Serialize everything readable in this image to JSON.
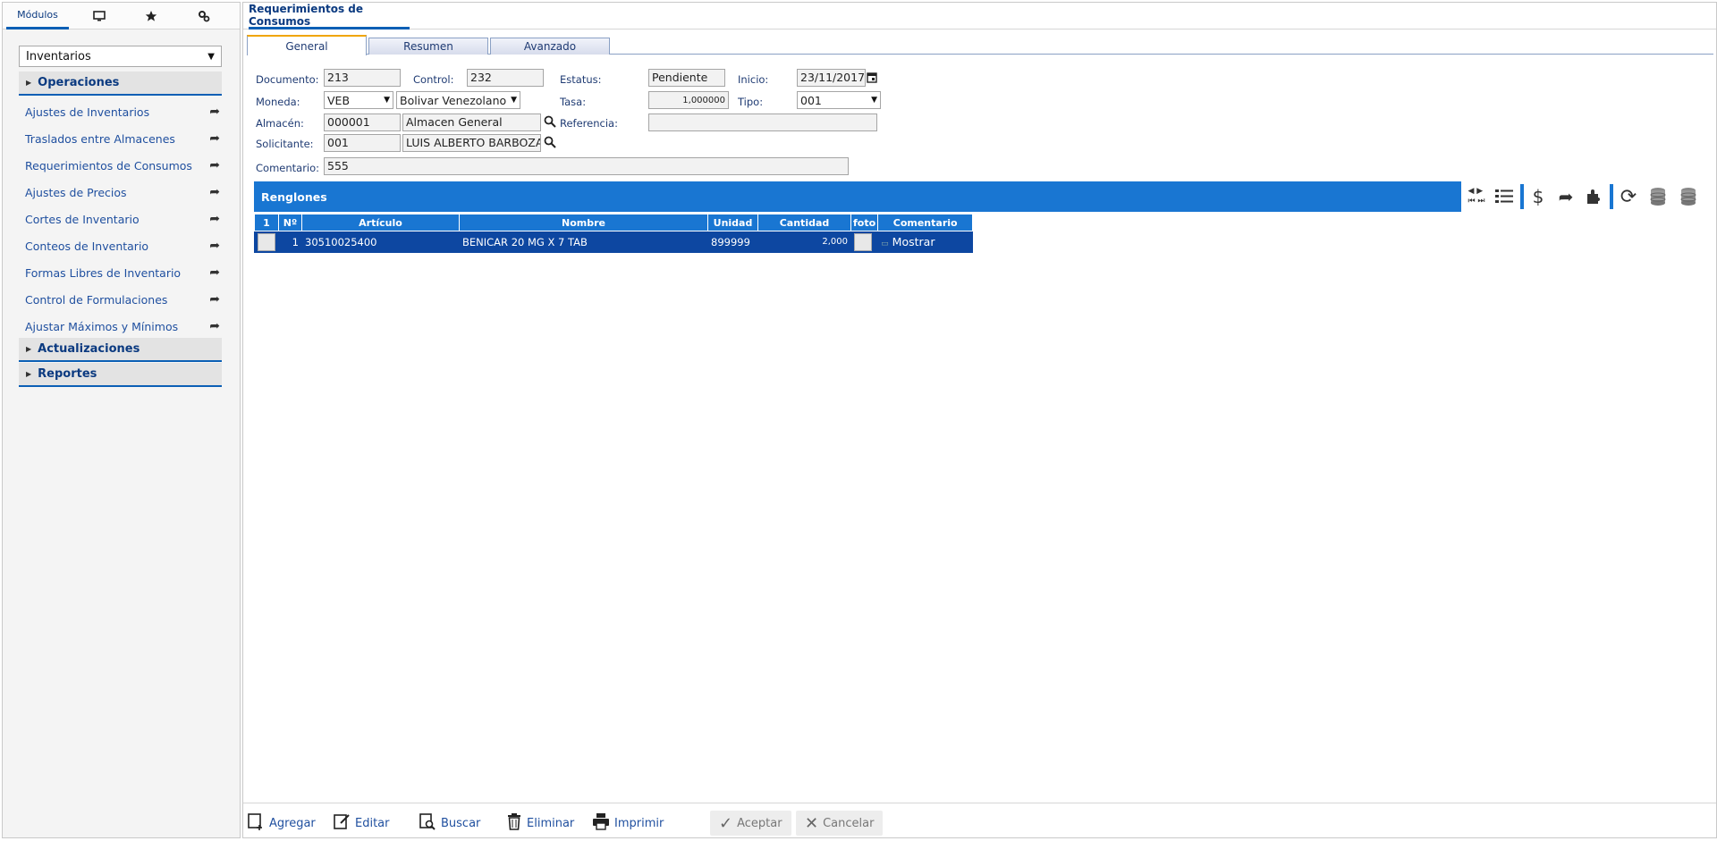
{
  "sidebar": {
    "tabs": [
      {
        "label": "Módulos",
        "icon": "modules"
      },
      {
        "label": "",
        "icon": "monitor-icon"
      },
      {
        "label": "",
        "icon": "star-icon"
      },
      {
        "label": "",
        "icon": "settings-icon"
      }
    ],
    "module_selected": "Inventarios",
    "sections": [
      {
        "label": "Operaciones"
      },
      {
        "label": "Actualizaciones"
      },
      {
        "label": "Reportes"
      }
    ],
    "items": [
      "Ajustes de Inventarios",
      "Traslados entre Almacenes",
      "Requerimientos de Consumos",
      "Ajustes de Precios",
      "Cortes de Inventario",
      "Conteos de Inventario",
      "Formas Libres de Inventario",
      "Control de Formulaciones",
      "Ajustar Máximos y Mínimos"
    ]
  },
  "main": {
    "title": "Requerimientos de Consumos",
    "tabs": [
      "General",
      "Resumen",
      "Avanzado"
    ],
    "form": {
      "documento_label": "Documento:",
      "documento": "213",
      "control_label": "Control:",
      "control": "232",
      "estatus_label": "Estatus:",
      "estatus": "Pendiente",
      "inicio_label": "Inicio:",
      "inicio": "23/11/2017",
      "moneda_label": "Moneda:",
      "moneda_code": "VEB",
      "moneda_name": "Bolivar Venezolano",
      "tasa_label": "Tasa:",
      "tasa": "1,000000",
      "tipo_label": "Tipo:",
      "tipo": "001",
      "almacen_label": "Almacén:",
      "almacen_code": "000001",
      "almacen_name": "Almacen General",
      "referencia_label": "Referencia:",
      "referencia": "",
      "solicitante_label": "Solicitante:",
      "solicitante_code": "001",
      "solicitante_name": "LUIS ALBERTO BARBOZA",
      "comentario_label": "Comentario:",
      "comentario": "555"
    },
    "grid": {
      "title": "Renglones",
      "columns": [
        "1",
        "Nº",
        "Artículo",
        "Nombre",
        "Unidad",
        "Cantidad",
        "foto",
        "Comentario"
      ],
      "rows": [
        {
          "n": "1",
          "articulo": "30510025400",
          "nombre": "BENICAR 20 MG X 7 TAB",
          "unidad": "899999",
          "cantidad": "2,000",
          "comentario": "Mostrar"
        }
      ]
    },
    "bottom_buttons": {
      "agregar": "Agregar",
      "editar": "Editar",
      "buscar": "Buscar",
      "eliminar": "Eliminar",
      "imprimir": "Imprimir",
      "aceptar": "Aceptar",
      "cancelar": "Cancelar"
    }
  },
  "colors": {
    "accent": "#1976d2",
    "row_selected": "#0d47a1",
    "tab_active_top": "#f0a500"
  }
}
